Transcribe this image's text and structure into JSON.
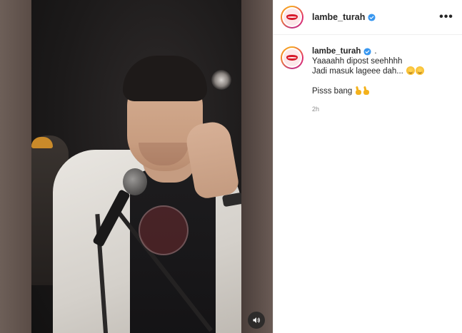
{
  "post": {
    "author": {
      "username": "lambe_turah",
      "verified": true
    },
    "more_options_icon": "more-horizontal-icon",
    "media": {
      "type": "video",
      "audio_icon": "speaker-icon"
    },
    "caption": {
      "username": "lambe_turah",
      "separator": ".",
      "line1": "Yaaaahh dipost seehhhh",
      "line2": "Jadi masuk lageee dah...",
      "line2_emojis": [
        "grinning-face-emoji",
        "grinning-face-emoji"
      ],
      "line3": "Pisss bang",
      "line3_emojis": [
        "victory-hand-emoji",
        "victory-hand-emoji"
      ],
      "timestamp": "2h"
    }
  },
  "colors": {
    "verified_badge": "#3897f0",
    "text_primary": "#262626",
    "text_secondary": "#8e8e8e",
    "divider": "#efefef"
  }
}
